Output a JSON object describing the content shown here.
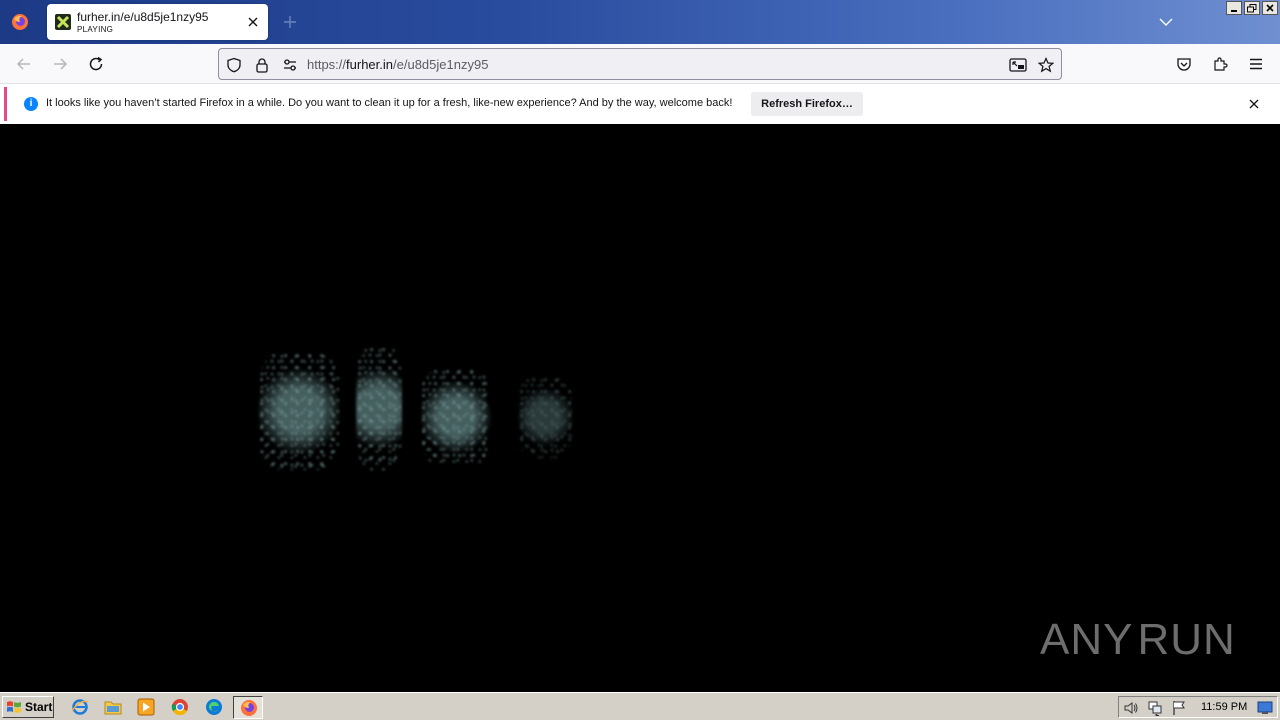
{
  "browser": {
    "tab": {
      "title": "furher.in/e/u8d5je1nzy95",
      "subtitle": "PLAYING"
    },
    "url": {
      "scheme": "https://",
      "host": "furher.in",
      "path": "/e/u8d5je1nzy95"
    }
  },
  "notification": {
    "message": "It looks like you haven’t started Firefox in a while. Do you want to clean it up for a fresh, like-new experience? And by the way, welcome back!",
    "button_label": "Refresh Firefox…"
  },
  "watermark": {
    "text_left": "ANY",
    "text_right": "RUN"
  },
  "taskbar": {
    "start_label": "Start",
    "clock": "11:59 PM",
    "apps": [
      "internet-explorer-icon",
      "file-explorer-icon",
      "media-player-icon",
      "chrome-icon",
      "edge-icon",
      "firefox-icon"
    ]
  },
  "colors": {
    "tabstrip_start": "#1c3a86",
    "notification_accent": "#e14b8c",
    "info_blue": "#0a84ff",
    "content_bg": "#000000",
    "noise_tint": "#9ec4c4"
  }
}
